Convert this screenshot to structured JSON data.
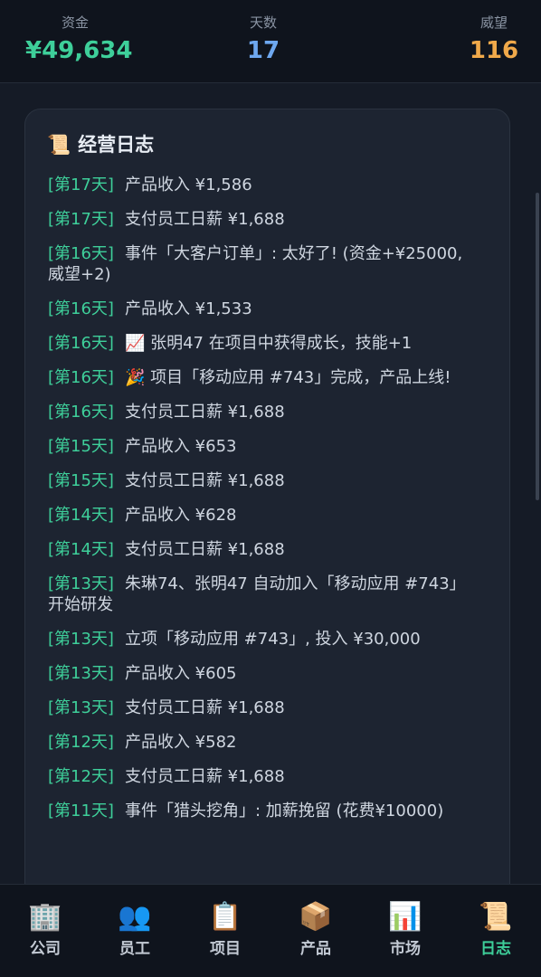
{
  "stats": {
    "money_label": "资金",
    "money_value": "¥49,634",
    "days_label": "天数",
    "days_value": "17",
    "rep_label": "威望",
    "rep_value": "116"
  },
  "log": {
    "icon": "📜",
    "title": "经营日志",
    "entries": [
      {
        "day": "[第17天]",
        "text": "产品收入 ¥1,586"
      },
      {
        "day": "[第17天]",
        "text": "支付员工日薪 ¥1,688"
      },
      {
        "day": "[第16天]",
        "text": "事件「大客户订单」: 太好了! (资金+¥25000, 威望+2)"
      },
      {
        "day": "[第16天]",
        "text": "产品收入 ¥1,533"
      },
      {
        "day": "[第16天]",
        "text": "📈 张明47 在项目中获得成长，技能+1"
      },
      {
        "day": "[第16天]",
        "text": "🎉 项目「移动应用 #743」完成，产品上线!"
      },
      {
        "day": "[第16天]",
        "text": "支付员工日薪 ¥1,688"
      },
      {
        "day": "[第15天]",
        "text": "产品收入 ¥653"
      },
      {
        "day": "[第15天]",
        "text": "支付员工日薪 ¥1,688"
      },
      {
        "day": "[第14天]",
        "text": "产品收入 ¥628"
      },
      {
        "day": "[第14天]",
        "text": "支付员工日薪 ¥1,688"
      },
      {
        "day": "[第13天]",
        "text": "朱琳74、张明47 自动加入「移动应用 #743」开始研发"
      },
      {
        "day": "[第13天]",
        "text": "立项「移动应用 #743」, 投入 ¥30,000"
      },
      {
        "day": "[第13天]",
        "text": "产品收入 ¥605"
      },
      {
        "day": "[第13天]",
        "text": "支付员工日薪 ¥1,688"
      },
      {
        "day": "[第12天]",
        "text": "产品收入 ¥582"
      },
      {
        "day": "[第12天]",
        "text": "支付员工日薪 ¥1,688"
      },
      {
        "day": "[第11天]",
        "text": "事件「猎头挖角」: 加薪挽留 (花费¥10000)"
      }
    ]
  },
  "nav": {
    "items": [
      {
        "icon": "🏢",
        "label": "公司"
      },
      {
        "icon": "👥",
        "label": "员工"
      },
      {
        "icon": "📋",
        "label": "项目"
      },
      {
        "icon": "📦",
        "label": "产品"
      },
      {
        "icon": "📊",
        "label": "市场"
      },
      {
        "icon": "📜",
        "label": "日志"
      }
    ],
    "active": "日志"
  },
  "colors": {
    "accent": "#3ecf9a",
    "days": "#6ea8f0",
    "reputation": "#f0a94a",
    "background": "#151b26",
    "card": "#1d2431"
  }
}
